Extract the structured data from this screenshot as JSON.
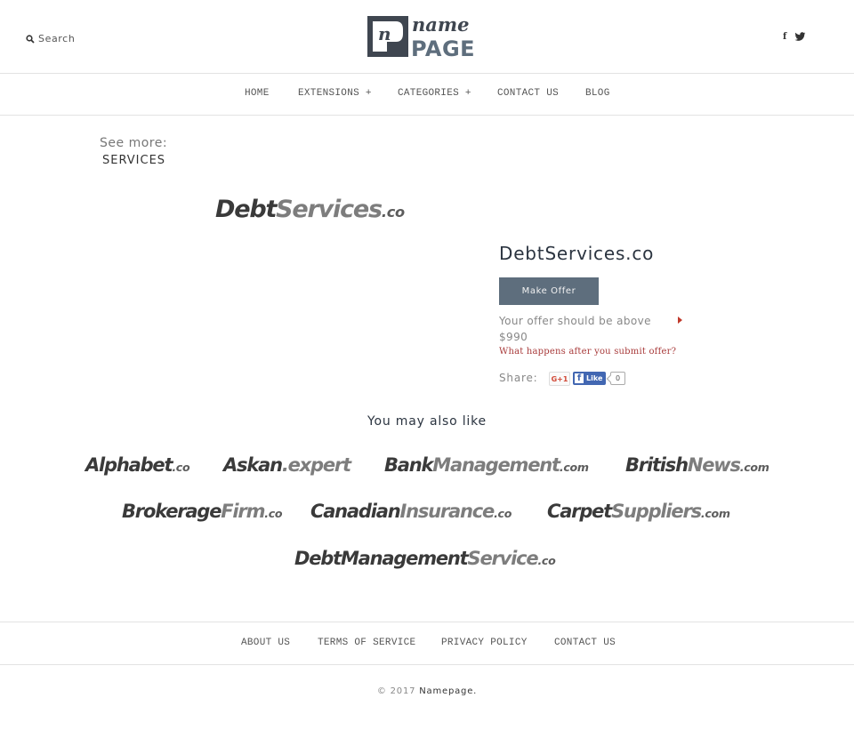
{
  "header": {
    "search_label": "Search",
    "logo": {
      "top_word": "name",
      "bottom_word": "PAGE",
      "badge_letter": "n"
    },
    "social": [
      {
        "name": "facebook",
        "glyph": "f"
      },
      {
        "name": "twitter",
        "glyph": "twitter-bird"
      }
    ]
  },
  "nav": {
    "items": [
      {
        "label": "HOME"
      },
      {
        "label": "EXTENSIONS +"
      },
      {
        "label": "CATEGORIES +"
      },
      {
        "label": "CONTACT US"
      },
      {
        "label": "BLOG"
      }
    ]
  },
  "see_more": {
    "label": "See more:",
    "category": "SERVICES"
  },
  "domain": {
    "logo": {
      "part_a": "Debt",
      "part_b": "Services",
      "tld": ".co"
    },
    "name": "DebtServices.co",
    "make_offer_label": "Make Offer",
    "offer_hint": "Your offer should be above $990",
    "min_offer": "$990",
    "what_happens_label": "What happens after you submit offer?",
    "share_label": "Share:",
    "gplus_label": "G+1",
    "fb_like_label": "Like",
    "fb_like_count": "0"
  },
  "related": {
    "heading": "You may also like",
    "items": [
      {
        "a": "Alphabet",
        "b": "",
        "tld": ".co"
      },
      {
        "a": "Askan",
        "b": ".expert",
        "tld": ""
      },
      {
        "a": "Bank",
        "b": "Management",
        "tld": ".com"
      },
      {
        "a": "British",
        "b": "News",
        "tld": ".com"
      },
      {
        "a": "Brokerage",
        "b": "Firm",
        "tld": ".co"
      },
      {
        "a": "Canadian",
        "b": "Insurance",
        "tld": ".co"
      },
      {
        "a": "Carpet",
        "b": "Suppliers",
        "tld": ".com"
      },
      {
        "a": "DebtManagement",
        "b": "Service",
        "tld": ".co"
      }
    ]
  },
  "footer": {
    "links": [
      {
        "label": "ABOUT US"
      },
      {
        "label": "TERMS OF SERVICE"
      },
      {
        "label": "PRIVACY POLICY"
      },
      {
        "label": "CONTACT US"
      }
    ],
    "copyright_prefix": "© 2017",
    "brand": "Namepage."
  },
  "colors": {
    "button": "#5e6e7d",
    "link_red": "#a83a3a",
    "facebook_blue": "#4267b2",
    "text_dark": "#2b3440"
  }
}
